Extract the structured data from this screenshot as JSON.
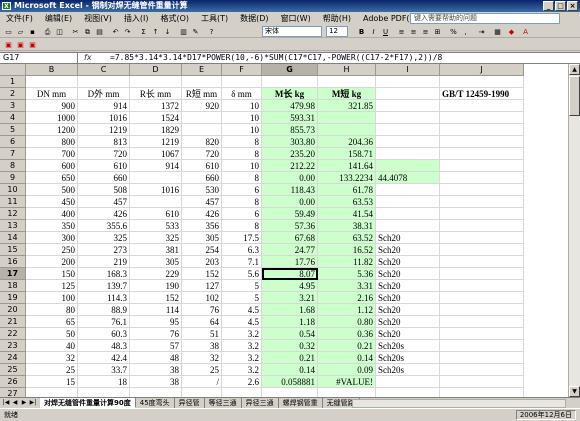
{
  "window": {
    "title": "Microsoft Excel - 钢制对焊无缝管件重量计算",
    "app_icon": "excel-icon"
  },
  "menu": {
    "items": [
      "文件(F)",
      "编辑(E)",
      "视图(V)",
      "插入(I)",
      "格式(O)",
      "工具(T)",
      "数据(D)",
      "窗口(W)",
      "帮助(H)",
      "Adobe PDF(B)"
    ],
    "help_placeholder": "键入需要帮助的问题"
  },
  "toolbar": {
    "font_name": "宋体",
    "font_size": "12"
  },
  "formula_bar": {
    "name_box": "G17",
    "fx": "fx",
    "formula": "=7.85*3.14*3.14*D17*POWER(10,-6)*SUM(C17*C17,-POWER((C17-2*F17),2))/8"
  },
  "columns": [
    "B",
    "C",
    "D",
    "E",
    "F",
    "G",
    "H",
    "I",
    "J"
  ],
  "selected_column": "G",
  "selected_row": "17",
  "rows": [
    {
      "n": "1",
      "c": [
        "",
        "",
        "",
        "",
        "",
        "",
        "",
        "",
        ""
      ]
    },
    {
      "n": "2",
      "c": [
        "DN mm",
        "D外 mm",
        "R长 mm",
        "R短 mm",
        "δ  mm",
        "M长 kg",
        "M短 kg",
        "",
        "GB/T 12459-1990"
      ]
    },
    {
      "n": "3",
      "c": [
        "900",
        "914",
        "1372",
        "920",
        "10",
        "479.98",
        "321.85",
        "",
        ""
      ]
    },
    {
      "n": "4",
      "c": [
        "1000",
        "1016",
        "1524",
        "",
        "10",
        "593.31",
        "",
        "",
        ""
      ]
    },
    {
      "n": "5",
      "c": [
        "1200",
        "1219",
        "1829",
        "",
        "10",
        "855.73",
        "",
        "",
        ""
      ]
    },
    {
      "n": "6",
      "c": [
        "800",
        "813",
        "1219",
        "820",
        "8",
        "303.80",
        "204.36",
        "",
        ""
      ]
    },
    {
      "n": "7",
      "c": [
        "700",
        "720",
        "1067",
        "720",
        "8",
        "235.20",
        "158.71",
        "",
        ""
      ]
    },
    {
      "n": "8",
      "c": [
        "600",
        "610",
        "914",
        "610",
        "10",
        "212.22",
        "141.64",
        "",
        ""
      ]
    },
    {
      "n": "9",
      "c": [
        "650",
        "660",
        "",
        "660",
        "8",
        "0.00",
        "133.2234",
        "44.4078",
        ""
      ]
    },
    {
      "n": "10",
      "c": [
        "500",
        "508",
        "1016",
        "530",
        "6",
        "118.43",
        "61.78",
        "",
        ""
      ]
    },
    {
      "n": "11",
      "c": [
        "450",
        "457",
        "",
        "457",
        "8",
        "0.00",
        "63.53",
        "",
        ""
      ]
    },
    {
      "n": "12",
      "c": [
        "400",
        "426",
        "610",
        "426",
        "6",
        "59.49",
        "41.54",
        "",
        ""
      ]
    },
    {
      "n": "13",
      "c": [
        "350",
        "355.6",
        "533",
        "356",
        "8",
        "57.36",
        "38.31",
        "",
        ""
      ]
    },
    {
      "n": "14",
      "c": [
        "300",
        "325",
        "325",
        "305",
        "17.5",
        "67.68",
        "63.52",
        "Sch20",
        ""
      ]
    },
    {
      "n": "15",
      "c": [
        "250",
        "273",
        "381",
        "254",
        "6.3",
        "24.77",
        "16.52",
        "Sch20",
        ""
      ]
    },
    {
      "n": "16",
      "c": [
        "200",
        "219",
        "305",
        "203",
        "7.1",
        "17.76",
        "11.82",
        "Sch20",
        ""
      ]
    },
    {
      "n": "17",
      "c": [
        "150",
        "168.3",
        "229",
        "152",
        "5.6",
        "8.07",
        "5.36",
        "Sch20",
        ""
      ]
    },
    {
      "n": "18",
      "c": [
        "125",
        "139.7",
        "190",
        "127",
        "5",
        "4.95",
        "3.31",
        "Sch20",
        ""
      ]
    },
    {
      "n": "19",
      "c": [
        "100",
        "114.3",
        "152",
        "102",
        "5",
        "3.21",
        "2.16",
        "Sch20",
        ""
      ]
    },
    {
      "n": "20",
      "c": [
        "80",
        "88.9",
        "114",
        "76",
        "4.5",
        "1.68",
        "1.12",
        "Sch20",
        ""
      ]
    },
    {
      "n": "21",
      "c": [
        "65",
        "76.1",
        "95",
        "64",
        "4.5",
        "1.18",
        "0.80",
        "Sch20",
        ""
      ]
    },
    {
      "n": "22",
      "c": [
        "50",
        "60.3",
        "76",
        "51",
        "3.2",
        "0.54",
        "0.36",
        "Sch20",
        ""
      ]
    },
    {
      "n": "23",
      "c": [
        "40",
        "48.3",
        "57",
        "38",
        "3.2",
        "0.32",
        "0.21",
        "Sch20s",
        ""
      ]
    },
    {
      "n": "24",
      "c": [
        "32",
        "42.4",
        "48",
        "32",
        "3.2",
        "0.21",
        "0.14",
        "Sch20s",
        ""
      ]
    },
    {
      "n": "25",
      "c": [
        "25",
        "33.7",
        "38",
        "25",
        "3.2",
        "0.14",
        "0.09",
        "Sch20s",
        ""
      ]
    },
    {
      "n": "26",
      "c": [
        "15",
        "18",
        "38",
        "/",
        "2.6",
        "0.058881",
        "#VALUE!",
        "",
        ""
      ]
    },
    {
      "n": "27",
      "c": [
        "",
        "",
        "",
        "",
        "",
        "",
        "",
        "",
        ""
      ]
    }
  ],
  "sheet_tabs": [
    "对焊无缝管件重量计算90度",
    "45度弯头",
    "异径管",
    "等径三通",
    "异径三通",
    "螺焊钢管重",
    "无缝管路"
  ],
  "active_tab": 0,
  "status": {
    "left": "就绪",
    "date": "2006年12月6日"
  }
}
